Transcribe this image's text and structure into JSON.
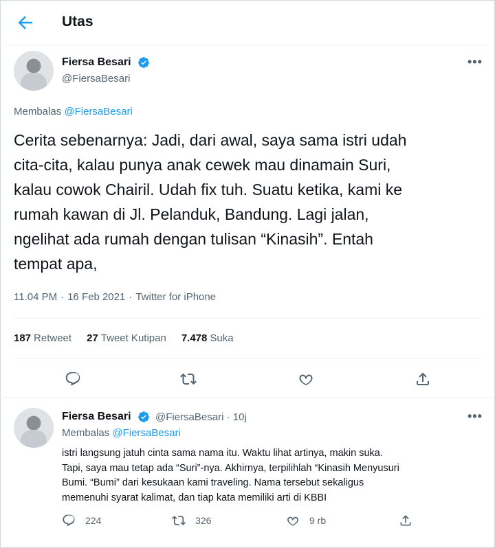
{
  "header": {
    "title": "Utas"
  },
  "main_tweet": {
    "author_name": "Fiersa Besari",
    "author_handle": "@FiersaBesari",
    "reply_prefix": "Membalas ",
    "reply_target": "@FiersaBesari",
    "text": "Cerita sebenarnya: Jadi, dari awal, saya sama istri udah\ncita-cita, kalau punya anak cewek mau dinamain Suri,\nkalau cowok Chairil. Udah fix tuh. Suatu ketika, kami ke\nrumah kawan di Jl. Pelanduk, Bandung. Lagi jalan,\nngelihat ada rumah dengan tulisan “Kinasih”. Entah\ntempat apa,",
    "time": "11.04 PM",
    "date": "16 Feb 2021",
    "source": "Twitter for iPhone",
    "retweets": "187",
    "retweets_label": "Retweet",
    "quotes": "27",
    "quotes_label": "Tweet Kutipan",
    "likes": "7.478",
    "likes_label": "Suka",
    "more": "•••"
  },
  "reply_tweet": {
    "author_name": "Fiersa Besari",
    "author_handle": "@FiersaBesari",
    "dot": "·",
    "age": "10j",
    "reply_prefix": "Membalas ",
    "reply_target": "@FiersaBesari",
    "text": "istri langsung jatuh cinta sama nama itu. Waktu lihat artinya, makin suka.\nTapi, saya mau tetap ada “Suri”-nya. Akhirnya, terpilihlah “Kinasih Menyusuri\nBumi. “Bumi” dari kesukaan kami traveling. Nama tersebut sekaligus\nmemenuhi syarat kalimat, dan tiap kata memiliki arti di KBBI",
    "replies": "224",
    "retweets": "326",
    "likes": "9 rb",
    "more": "•••"
  },
  "colors": {
    "accent": "#1d9bf0",
    "muted": "#536471",
    "text": "#0f1419"
  }
}
